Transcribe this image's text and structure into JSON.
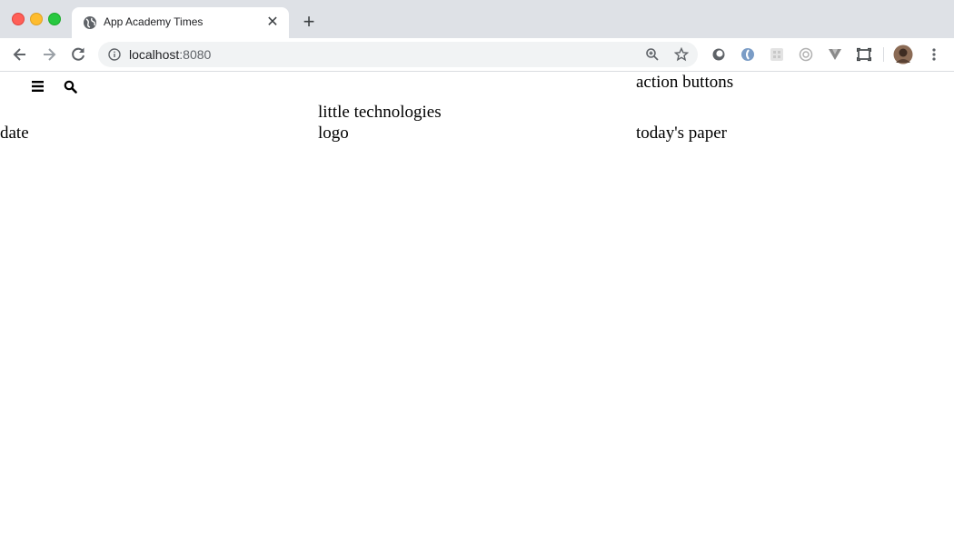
{
  "browser": {
    "tab_title": "App Academy Times",
    "close_glyph": "✕",
    "new_tab_glyph": "+",
    "url_host": "localhost",
    "url_port": ":8080"
  },
  "header": {
    "action_buttons": "action buttons",
    "tagline": "little technologies",
    "date": "date",
    "logo": "logo",
    "todays_paper": "today's paper"
  },
  "icons": [
    "globe-icon",
    "back-icon",
    "forward-icon",
    "reload-icon",
    "info-icon",
    "zoom-icon",
    "star-icon",
    "menu-icon",
    "search-icon",
    "more-icon"
  ]
}
